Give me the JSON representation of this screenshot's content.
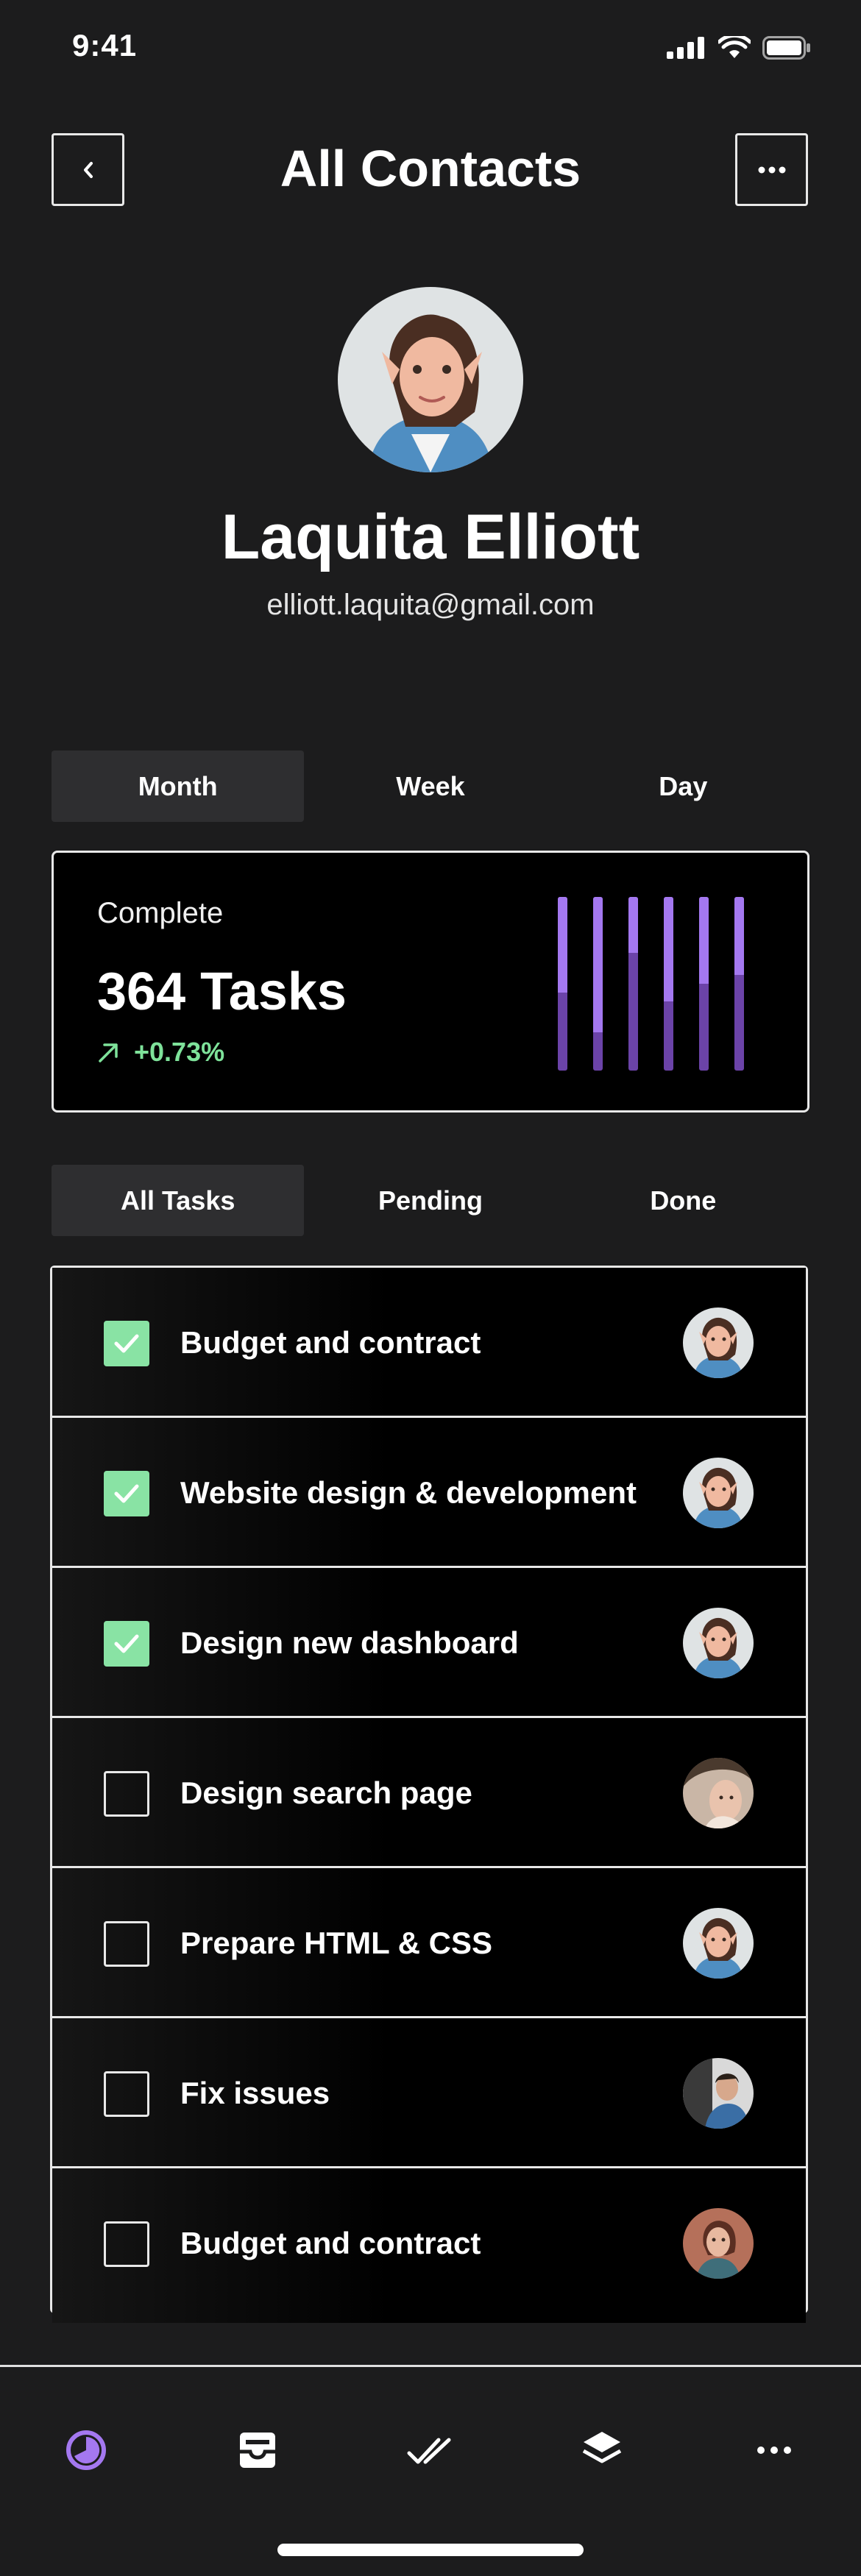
{
  "status_bar": {
    "time": "9:41"
  },
  "header": {
    "title": "All Contacts"
  },
  "profile": {
    "name": "Laquita Elliott",
    "email": "elliott.laquita@gmail.com"
  },
  "period_tabs": [
    {
      "label": "Month",
      "active": true
    },
    {
      "label": "Week",
      "active": false
    },
    {
      "label": "Day",
      "active": false
    }
  ],
  "stats": {
    "label": "Complete",
    "value": "364 Tasks",
    "change": "+0.73%",
    "change_color": "#7ee29a",
    "bar_levels": [
      0.55,
      0.78,
      0.32,
      0.6,
      0.5,
      0.45
    ]
  },
  "task_filters": [
    {
      "label": "All Tasks",
      "active": true
    },
    {
      "label": "Pending",
      "active": false
    },
    {
      "label": "Done",
      "active": false
    }
  ],
  "tasks": [
    {
      "title": "Budget and contract",
      "done": true,
      "avatar": "laquita"
    },
    {
      "title": "Website design & development",
      "done": true,
      "avatar": "laquita"
    },
    {
      "title": "Design new dashboard",
      "done": true,
      "avatar": "laquita"
    },
    {
      "title": "Design search page",
      "done": false,
      "avatar": "woman-hat"
    },
    {
      "title": "Prepare HTML & CSS",
      "done": false,
      "avatar": "laquita"
    },
    {
      "title": "Fix issues",
      "done": false,
      "avatar": "man-blue"
    },
    {
      "title": "Budget and contract",
      "done": false,
      "avatar": "woman-red"
    }
  ],
  "tab_bar": [
    {
      "icon": "pie-chart-icon",
      "active": true
    },
    {
      "icon": "inbox-icon",
      "active": false
    },
    {
      "icon": "double-check-icon",
      "active": false
    },
    {
      "icon": "layers-icon",
      "active": false
    },
    {
      "icon": "more-dots-icon",
      "active": false
    }
  ],
  "colors": {
    "background": "#1c1c1d",
    "accent": "#a478f0",
    "check_green": "#89e3a4"
  }
}
